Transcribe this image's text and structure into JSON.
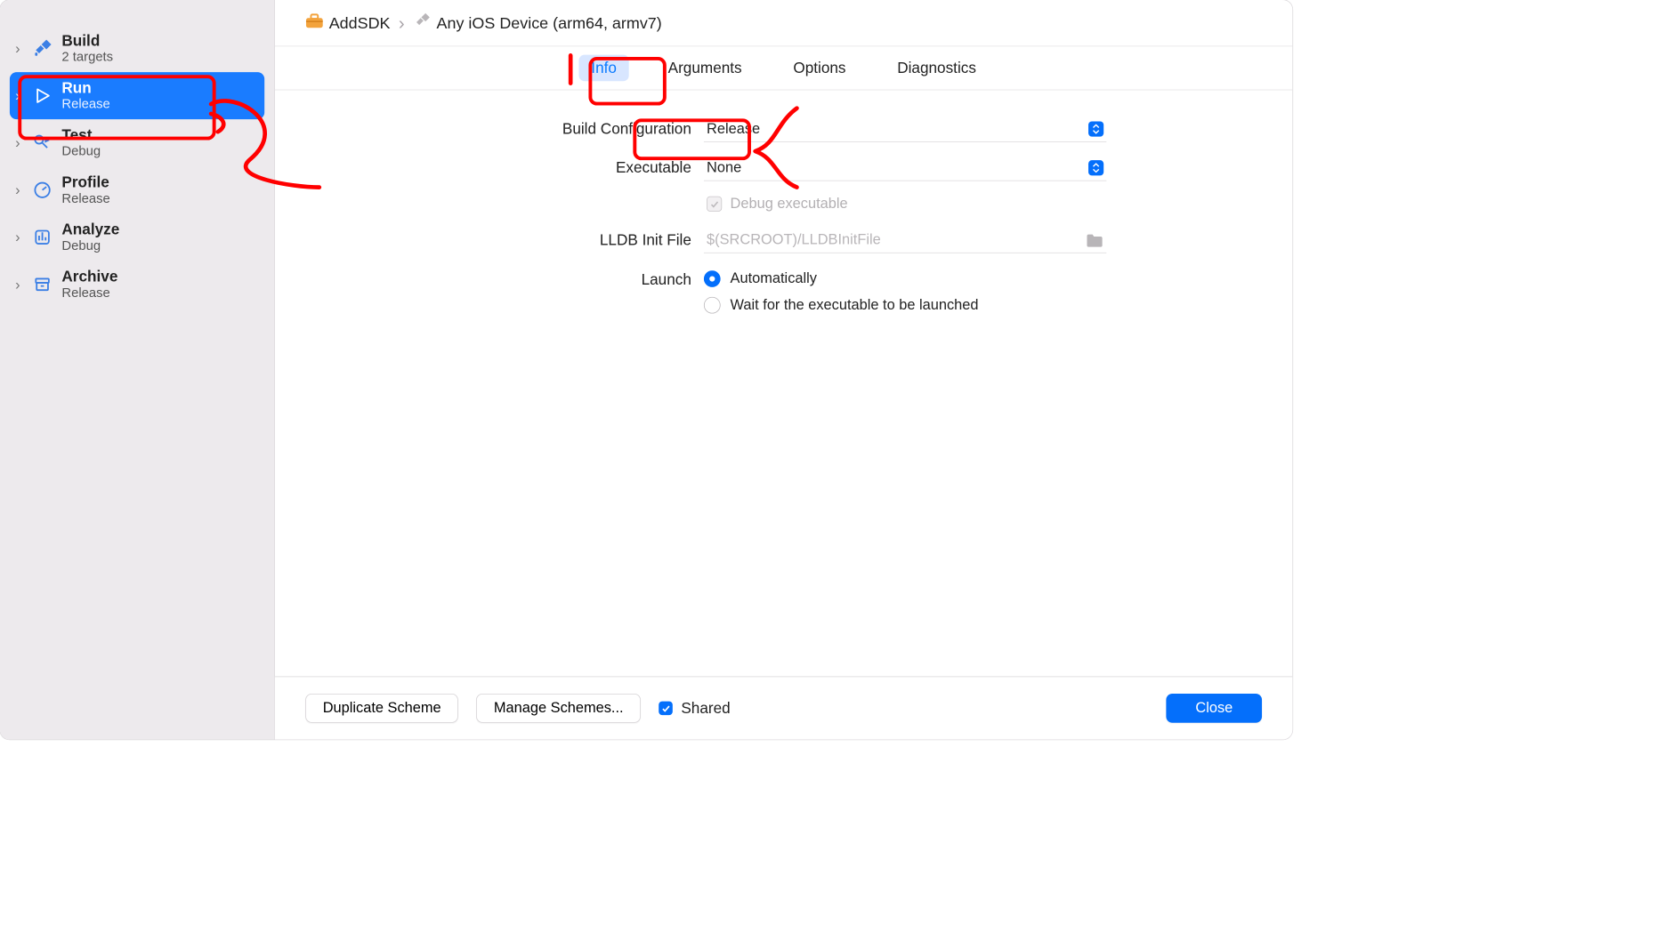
{
  "sidebar": {
    "items": [
      {
        "title": "Build",
        "subtitle": "2 targets",
        "icon": "hammer"
      },
      {
        "title": "Run",
        "subtitle": "Release",
        "icon": "play",
        "selected": true
      },
      {
        "title": "Test",
        "subtitle": "Debug",
        "icon": "test"
      },
      {
        "title": "Profile",
        "subtitle": "Release",
        "icon": "gauge"
      },
      {
        "title": "Analyze",
        "subtitle": "Debug",
        "icon": "analyze"
      },
      {
        "title": "Archive",
        "subtitle": "Release",
        "icon": "archive"
      }
    ]
  },
  "breadcrumb": {
    "project_icon": "toolbox",
    "project": "AddSDK",
    "target_icon": "hammer-grey",
    "target": "Any iOS Device (arm64, armv7)"
  },
  "tabs": [
    {
      "label": "Info",
      "selected": true
    },
    {
      "label": "Arguments"
    },
    {
      "label": "Options"
    },
    {
      "label": "Diagnostics"
    }
  ],
  "form": {
    "build_configuration": {
      "label": "Build Configuration",
      "value": "Release"
    },
    "executable": {
      "label": "Executable",
      "value": "None"
    },
    "debug_executable": {
      "label": "Debug executable",
      "checked": true,
      "enabled": false
    },
    "lldb": {
      "label": "LLDB Init File",
      "placeholder": "$(SRCROOT)/LLDBInitFile"
    },
    "launch": {
      "label": "Launch",
      "options": [
        {
          "label": "Automatically",
          "checked": true
        },
        {
          "label": "Wait for the executable to be launched",
          "checked": false
        }
      ]
    }
  },
  "footer": {
    "duplicate": "Duplicate Scheme",
    "manage": "Manage Schemes...",
    "shared": {
      "label": "Shared",
      "checked": true
    },
    "close": "Close"
  }
}
